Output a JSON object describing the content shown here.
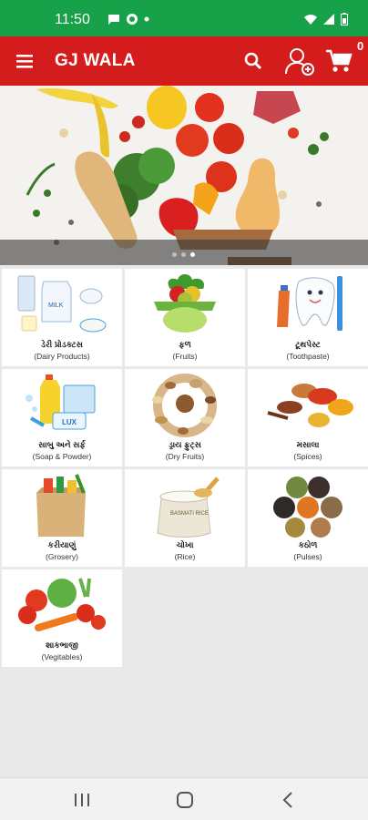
{
  "status_bar": {
    "time": "11:50"
  },
  "app_bar": {
    "title": "GJ WALA",
    "cart_count": "0"
  },
  "banner": {
    "slide_count": 3,
    "active_slide": 3
  },
  "categories": [
    {
      "name": "ડેરી પ્રોડક્ટસ",
      "subtitle": "(Dairy Products)"
    },
    {
      "name": "ફળ",
      "subtitle": "(Fruits)"
    },
    {
      "name": "ટૂથપેસ્ટ",
      "subtitle": "(Toothpaste)"
    },
    {
      "name": "સાબુ અને સર્ફ",
      "subtitle": "(Soap & Powder)"
    },
    {
      "name": "ડ્રાય ફ્રુટ્સ",
      "subtitle": "(Dry Fruits)"
    },
    {
      "name": "મસાલા",
      "subtitle": "(Spices)"
    },
    {
      "name": "કરીયાણું",
      "subtitle": "(Grosery)"
    },
    {
      "name": "ચોખા",
      "subtitle": "(Rice)"
    },
    {
      "name": "કઠોળ",
      "subtitle": "(Pulses)"
    },
    {
      "name": "શાકભાજી",
      "subtitle": "(Vegitables)"
    }
  ],
  "rice_bag_label": "BASMATI RICE",
  "milk_label": "MILK",
  "soap_label": "LUX",
  "icons": [
    "menu-icon",
    "search-icon",
    "add-user-icon",
    "cart-icon",
    "recents-icon",
    "home-icon",
    "back-icon"
  ],
  "colors": {
    "status_bar": "#17a24a",
    "app_bar": "#d41c1c",
    "background": "#e9e9e9"
  }
}
